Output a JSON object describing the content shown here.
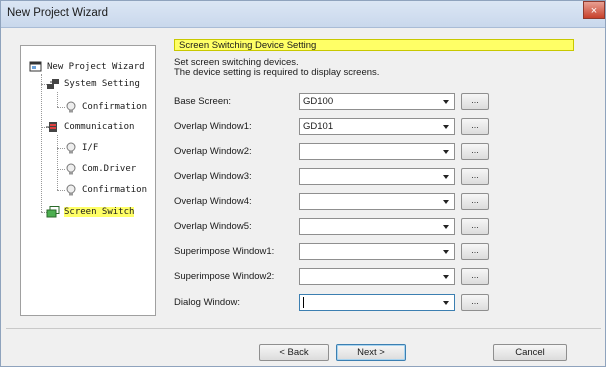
{
  "window": {
    "title": "New Project Wizard",
    "close_glyph": "×"
  },
  "tree": {
    "items": [
      {
        "label": "New Project Wizard",
        "icon": "project-icon"
      },
      {
        "label": "System Setting",
        "icon": "system-icon"
      },
      {
        "label": "Confirmation",
        "icon": "bulb-icon"
      },
      {
        "label": "Communication",
        "icon": "communication-icon"
      },
      {
        "label": "I/F",
        "icon": "bulb-icon"
      },
      {
        "label": "Com.Driver",
        "icon": "bulb-icon"
      },
      {
        "label": "Confirmation",
        "icon": "bulb-icon"
      },
      {
        "label": "Screen Switch",
        "icon": "screen-switch-icon",
        "selected": true
      }
    ]
  },
  "section": {
    "title": "Screen Switching Device Setting",
    "desc_line1": "Set screen switching devices.",
    "desc_line2": "The device setting is required to display screens."
  },
  "fields": [
    {
      "label": "Base Screen:",
      "value": "GD100"
    },
    {
      "label": "Overlap Window1:",
      "value": "GD101"
    },
    {
      "label": "Overlap Window2:",
      "value": ""
    },
    {
      "label": "Overlap Window3:",
      "value": ""
    },
    {
      "label": "Overlap Window4:",
      "value": ""
    },
    {
      "label": "Overlap Window5:",
      "value": ""
    },
    {
      "label": "Superimpose Window1:",
      "value": ""
    },
    {
      "label": "Superimpose Window2:",
      "value": ""
    },
    {
      "label": "Dialog Window:",
      "value": ""
    }
  ],
  "browse_label": "...",
  "buttons": {
    "back": "< Back",
    "next": "Next >",
    "cancel": "Cancel"
  },
  "colors": {
    "selection_highlight": "#ffff66",
    "titlebar": "#c9d8ec",
    "close": "#c7402b"
  }
}
